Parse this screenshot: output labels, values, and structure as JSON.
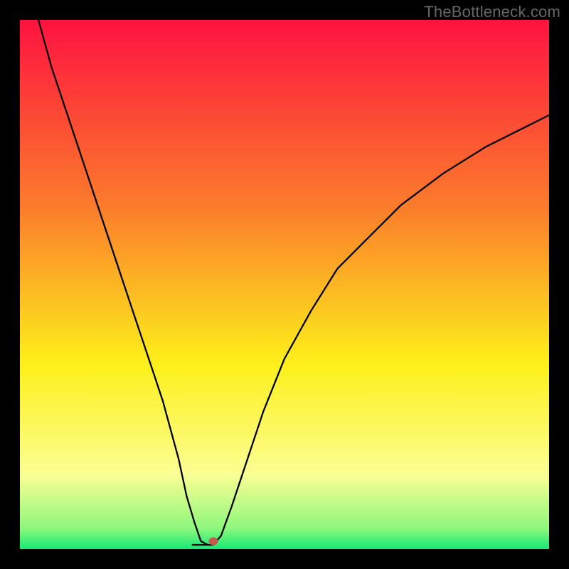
{
  "watermark": {
    "text": "TheBottleneck.com"
  },
  "chart_data": {
    "type": "line",
    "title": "",
    "xlabel": "",
    "ylabel": "",
    "xlim": [
      0,
      100
    ],
    "ylim": [
      0,
      100
    ],
    "gradient_bands": [
      {
        "label": "red-top",
        "pos": 0.0,
        "color": "#fe1340"
      },
      {
        "label": "orange",
        "pos": 0.35,
        "color": "#fb7b2b"
      },
      {
        "label": "yellow",
        "pos": 0.65,
        "color": "#fdf01a"
      },
      {
        "label": "pale",
        "pos": 0.86,
        "color": "#fbfe94"
      },
      {
        "label": "lightgrn",
        "pos": 0.96,
        "color": "#8ef87c"
      },
      {
        "label": "green",
        "pos": 1.0,
        "color": "#16e977"
      }
    ],
    "series": [
      {
        "name": "bottleneck-curve",
        "color": "#000000",
        "x": [
          3.5,
          6,
          9,
          12,
          15,
          18,
          21,
          24,
          27,
          30,
          31.5,
          33,
          34.2,
          35.5,
          36.5,
          38,
          40,
          43,
          46,
          50,
          55,
          60,
          66,
          72,
          80,
          88,
          96,
          100
        ],
        "y": [
          100,
          91,
          82,
          73,
          64,
          55,
          46,
          37,
          28,
          17,
          10,
          5,
          1.5,
          0.8,
          0.8,
          2.5,
          8,
          17,
          26,
          36,
          45,
          53,
          59,
          65,
          71,
          76,
          80,
          82
        ]
      }
    ],
    "marker": {
      "x": 36.5,
      "y": 1.5,
      "color": "#c45a4a"
    },
    "flat_segment": {
      "x0": 32.5,
      "x1": 35.5,
      "y": 0.8
    }
  }
}
